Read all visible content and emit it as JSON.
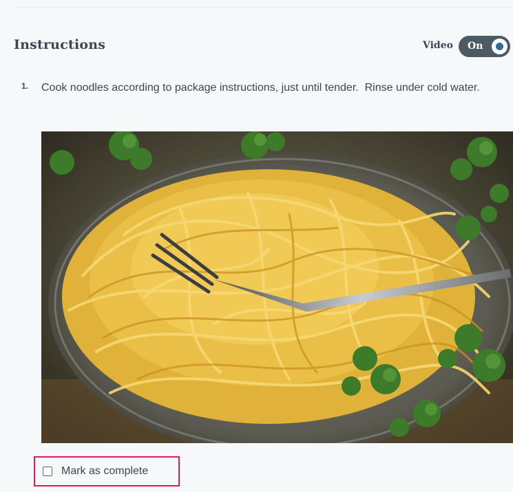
{
  "section": {
    "title": "Instructions"
  },
  "video": {
    "label": "Video",
    "toggle_state": "On"
  },
  "steps": [
    {
      "number": "1.",
      "text": "Cook noodles according to package instructions, just until tender.  Rinse under cold water.",
      "image_icon": "spaghetti-photo"
    }
  ],
  "mark_complete": {
    "label": "Mark as complete",
    "checked": false
  },
  "colors": {
    "background": "#f5f9fa",
    "text": "#3a4750",
    "toggle_bg": "#4b5a63",
    "toggle_dot": "#2c6e98",
    "highlight_border": "#e0185f"
  }
}
